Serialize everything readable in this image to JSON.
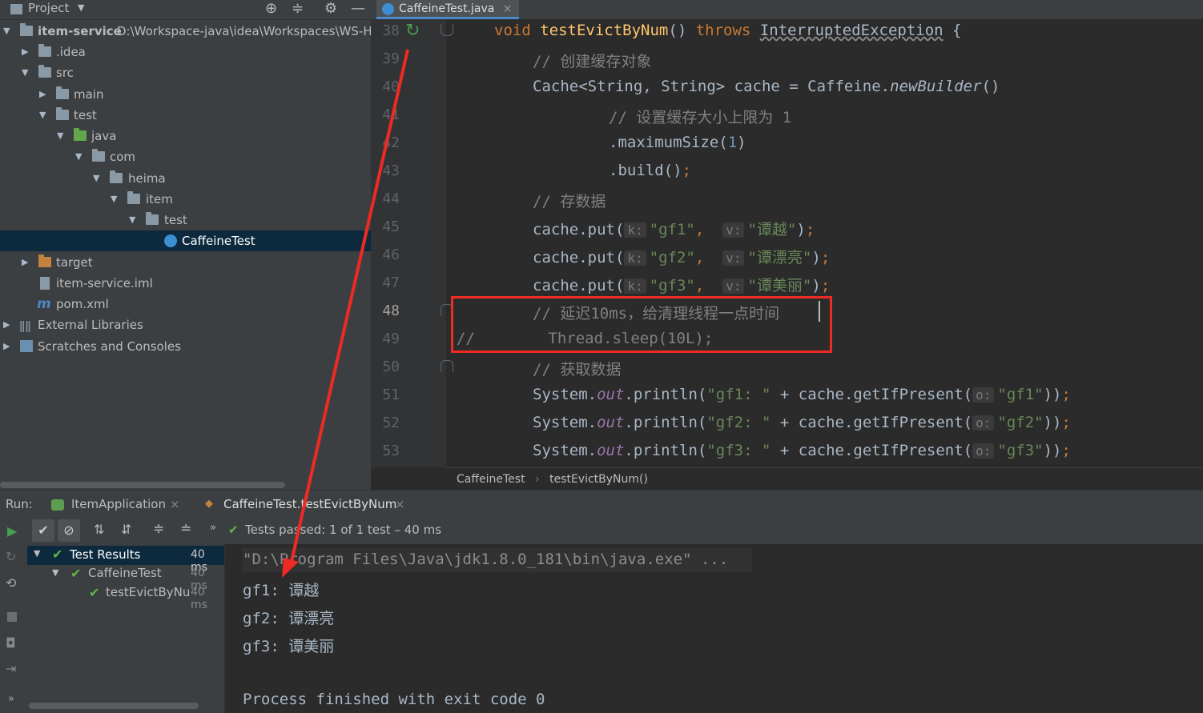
{
  "project": {
    "title": "Project",
    "root_name": "item-service",
    "root_path": "D:\\Workspace-java\\idea\\Workspaces\\WS-HM",
    "tree": [
      {
        "label": ".idea"
      },
      {
        "label": "src"
      },
      {
        "label": "main"
      },
      {
        "label": "test"
      },
      {
        "label": "java"
      },
      {
        "label": "com"
      },
      {
        "label": "heima"
      },
      {
        "label": "item"
      },
      {
        "label": "test"
      },
      {
        "label": "CaffeineTest"
      },
      {
        "label": "target"
      },
      {
        "label": "item-service.iml"
      },
      {
        "label": "pom.xml"
      },
      {
        "label": "External Libraries"
      },
      {
        "label": "Scratches and Consoles"
      }
    ]
  },
  "editor": {
    "tab_label": "CaffeineTest.java",
    "line_numbers": [
      "38",
      "39",
      "40",
      "41",
      "42",
      "43",
      "44",
      "45",
      "46",
      "47",
      "48",
      "49",
      "50",
      "51",
      "52",
      "53"
    ],
    "lines": {
      "l38": {
        "kw1": "void",
        "fn": "testEvictByNum",
        "paren": "()",
        "kw2": "throws",
        "exc": "InterruptedException",
        "brace": "{"
      },
      "l39": {
        "comment": "// 创建缓存对象"
      },
      "l40": {
        "text_a": "Cache<String, String> cache = Caffeine.",
        "method": "newBuilder",
        "text_b": "()"
      },
      "l41": {
        "comment": "// 设置缓存大小上限为 1"
      },
      "l42": {
        "text_a": ".maximumSize(",
        "num": "1",
        "text_b": ")"
      },
      "l43": {
        "text_a": ".build()",
        "semi": ";"
      },
      "l44": {
        "comment": "// 存数据"
      },
      "l45": {
        "call": "cache.put(",
        "hk": "k:",
        "key": "\"gf1\"",
        "comma": ",",
        "hv": "v:",
        "val": "\"谭越\"",
        "end": ")",
        "semi": ";"
      },
      "l46": {
        "call": "cache.put(",
        "hk": "k:",
        "key": "\"gf2\"",
        "comma": ",",
        "hv": "v:",
        "val": "\"谭漂亮\"",
        "end": ")",
        "semi": ";"
      },
      "l47": {
        "call": "cache.put(",
        "hk": "k:",
        "key": "\"gf3\"",
        "comma": ",",
        "hv": "v:",
        "val": "\"谭美丽\"",
        "end": ")",
        "semi": ";"
      },
      "l48": {
        "comment": "// 延迟10ms，给清理线程一点时间"
      },
      "l49": {
        "comment": "//        Thread.sleep(10L);"
      },
      "l50": {
        "comment": "// 获取数据"
      },
      "l51": {
        "pre": "System.",
        "out": "out",
        "mid": ".println(",
        "str": "\"gf1: \"",
        "plus": " + cache.getIfPresent(",
        "ho": "o:",
        "arg": "\"gf1\"",
        "end": "))",
        "semi": ";"
      },
      "l52": {
        "pre": "System.",
        "out": "out",
        "mid": ".println(",
        "str": "\"gf2: \"",
        "plus": " + cache.getIfPresent(",
        "ho": "o:",
        "arg": "\"gf2\"",
        "end": "))",
        "semi": ";"
      },
      "l53": {
        "pre": "System.",
        "out": "out",
        "mid": ".println(",
        "str": "\"gf3: \"",
        "plus": " + cache.getIfPresent(",
        "ho": "o:",
        "arg": "\"gf3\"",
        "end": "))",
        "semi": ";"
      }
    },
    "breadcrumb": {
      "class": "CaffeineTest",
      "sep": "›",
      "method": "testEvictByNum()"
    }
  },
  "run": {
    "label": "Run:",
    "tabs": [
      {
        "label": "ItemApplication"
      },
      {
        "label": "CaffeineTest.testEvictByNum"
      }
    ],
    "status": "Tests passed: 1 of 1 test – 40 ms",
    "results": [
      {
        "label": "Test Results",
        "time": "40 ms"
      },
      {
        "label": "CaffeineTest",
        "time": "40 ms"
      },
      {
        "label": "testEvictByNu",
        "time": "40 ms"
      }
    ],
    "console": [
      "\"D:\\Program Files\\Java\\jdk1.8.0_181\\bin\\java.exe\" ...",
      "gf1: 谭越",
      "gf2: 谭漂亮",
      "gf3: 谭美丽",
      "",
      "Process finished with exit code 0"
    ]
  },
  "colors": {
    "accent": "#4a88c7",
    "annotation": "#ee2a24",
    "pass": "#5fb34a"
  }
}
